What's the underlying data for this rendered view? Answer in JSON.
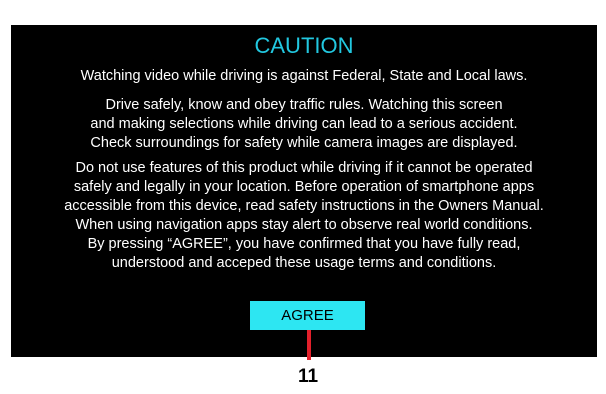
{
  "dialog": {
    "title": "CAUTION",
    "paragraph1": "Watching video while driving is against Federal, State and Local laws.",
    "paragraph2": [
      "Drive safely, know and obey traffic rules. Watching this screen",
      "and making selections while driving can lead to a serious accident.",
      "Check surroundings for safety while camera images are displayed."
    ],
    "paragraph3": [
      "Do not use features of this product while driving if it cannot be operated",
      "safely and legally in your location. Before operation of smartphone apps",
      "accessible from this device, read safety instructions in the Owners Manual.",
      "When using navigation apps stay alert to observe real world conditions.",
      "By pressing “AGREE”, you have confirmed that you have fully read,",
      "understood and acceped these usage terms and conditions."
    ],
    "agree_label": "AGREE"
  },
  "callout": {
    "number": "11"
  },
  "colors": {
    "title": "#22c8e0",
    "button": "#2de6f2",
    "callout_line": "#e3202b",
    "screen": "#000000"
  }
}
